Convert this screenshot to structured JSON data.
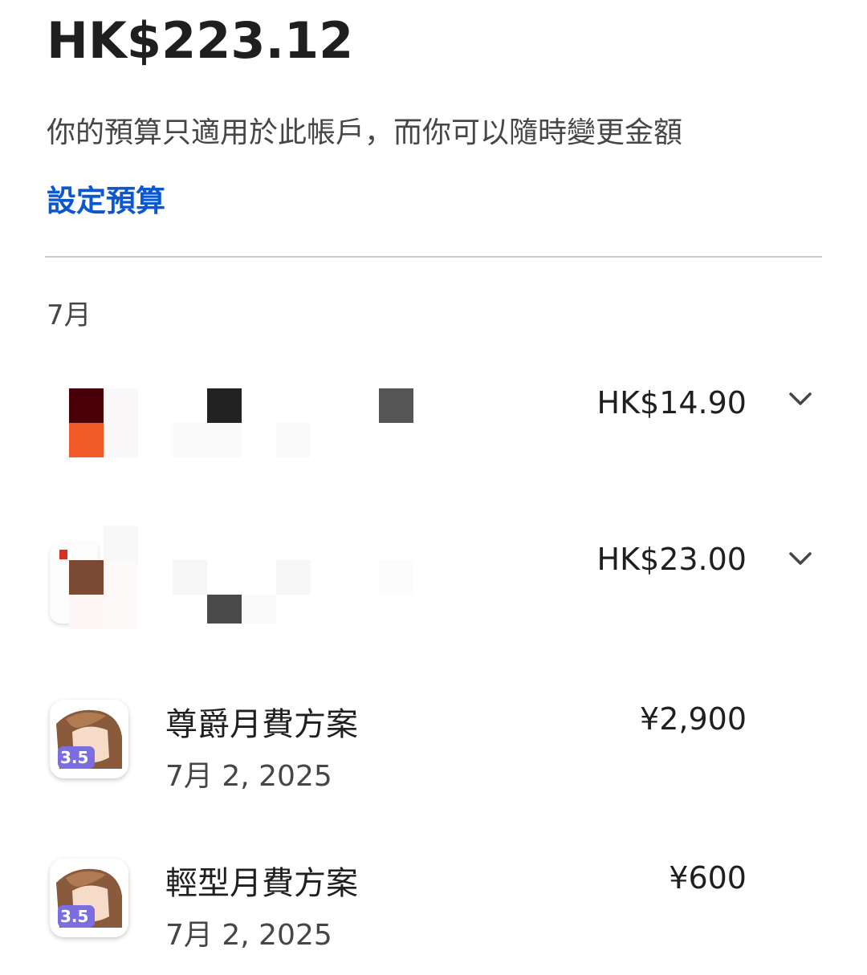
{
  "budget": {
    "total": "HK$223.12",
    "description": "你的預算只適用於此帳戶，而你可以隨時變更金額",
    "set_budget_label": "設定預算"
  },
  "month_label": "7月",
  "transactions": [
    {
      "amount": "HK$14.90",
      "redacted": true,
      "icon": "chevron-down-icon"
    },
    {
      "amount": "HK$23.00",
      "redacted": true,
      "icon": "chevron-down-icon"
    },
    {
      "title": "尊爵月費方案",
      "date": "7月 2, 2025",
      "amount": "¥2,900",
      "app_badge": "3.5"
    },
    {
      "title": "輕型月費方案",
      "date": "7月 2, 2025",
      "amount": "¥600",
      "app_badge": "3.5"
    }
  ],
  "colors": {
    "link": "#0b57d0",
    "text": "#1f1f1f",
    "muted": "#444746",
    "divider": "#c9cbcf"
  }
}
